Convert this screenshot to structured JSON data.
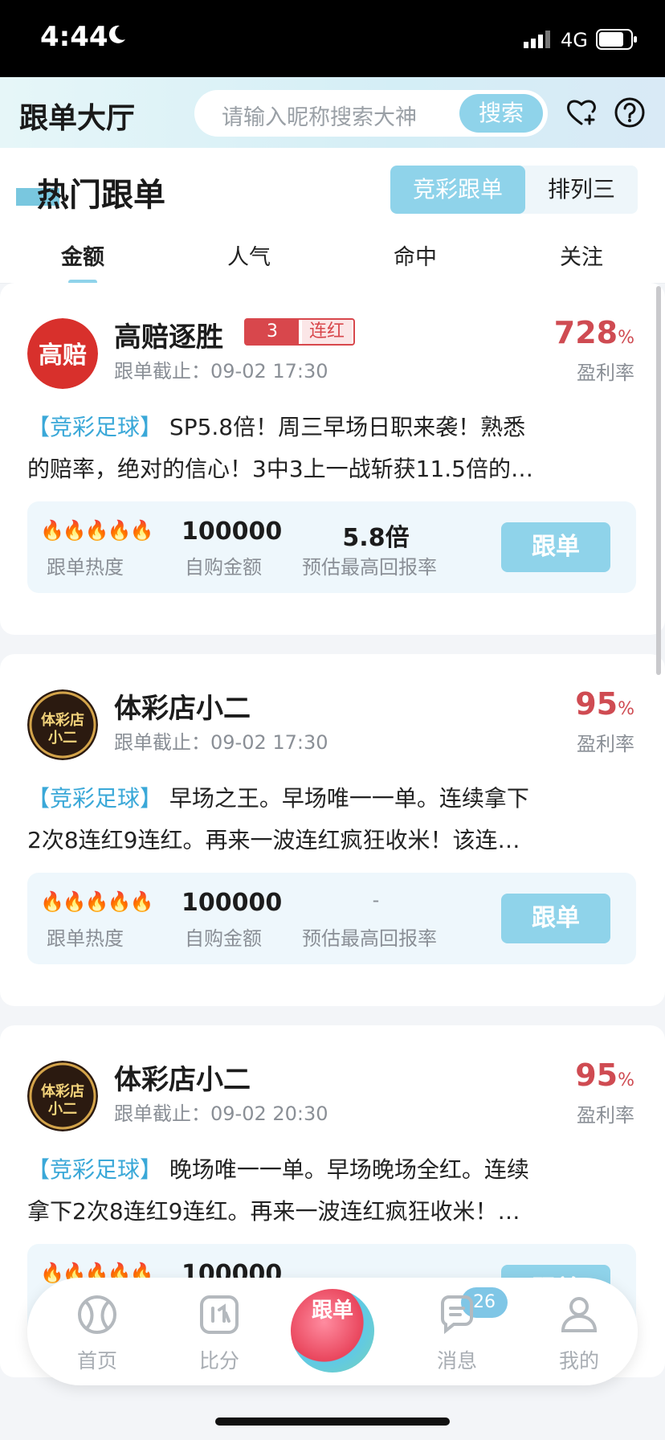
{
  "status_bar": {
    "time": "4:44",
    "network": "4G"
  },
  "header": {
    "title": "跟单大厅",
    "search_placeholder": "请输入昵称搜索大神",
    "search_button": "搜索"
  },
  "hot": {
    "title": "热门跟单",
    "segments": [
      "竞彩跟单",
      "排列三"
    ],
    "tabs": [
      "金额",
      "人气",
      "命中",
      "关注"
    ]
  },
  "stats_labels": {
    "heat": "跟单热度",
    "self_buy": "自购金额",
    "max_return": "预估最高回报率",
    "follow_button": "跟单"
  },
  "rate_label": "盈利率",
  "cards": [
    {
      "name": "高赔逐胜",
      "avatar_text": "高赔",
      "streak_count": "3",
      "streak_label": "连红",
      "deadline": "跟单截止：09-02 17:30",
      "rate": "728",
      "tag": "【竞彩足球】",
      "desc1": " SP5.8倍！周三早场日职来袭！熟悉",
      "desc2": "的赔率，绝对的信心！3中3上一战斩获11.5倍的…",
      "heat": 5,
      "amount": "100000",
      "max_return": "5.8倍"
    },
    {
      "name": "体彩店小二",
      "avatar_text": "体彩店小二",
      "deadline": "跟单截止：09-02 17:30",
      "rate": "95",
      "tag": "【竞彩足球】",
      "desc1": " 早场之王。早场唯一一单。连续拿下",
      "desc2": "2次8连红9连红。再来一波连红疯狂收米！该连…",
      "heat": 5,
      "amount": "100000",
      "max_return": "-"
    },
    {
      "name": "体彩店小二",
      "avatar_text": "体彩店小二",
      "deadline": "跟单截止：09-02 20:30",
      "rate": "95",
      "tag": "【竞彩足球】",
      "desc1": " 晚场唯一一单。早场晚场全红。连续",
      "desc2": "拿下2次8连红9连红。再来一波连红疯狂收米！…",
      "heat": 5,
      "amount": "100000",
      "max_return": ""
    }
  ],
  "bottom_nav": {
    "items": [
      "首页",
      "比分",
      "跟单",
      "消息",
      "我的"
    ],
    "message_badge": "26"
  },
  "colors": {
    "accent": "#8fd3ea",
    "rate": "#cf4b52",
    "tag": "#3aa8d8"
  }
}
